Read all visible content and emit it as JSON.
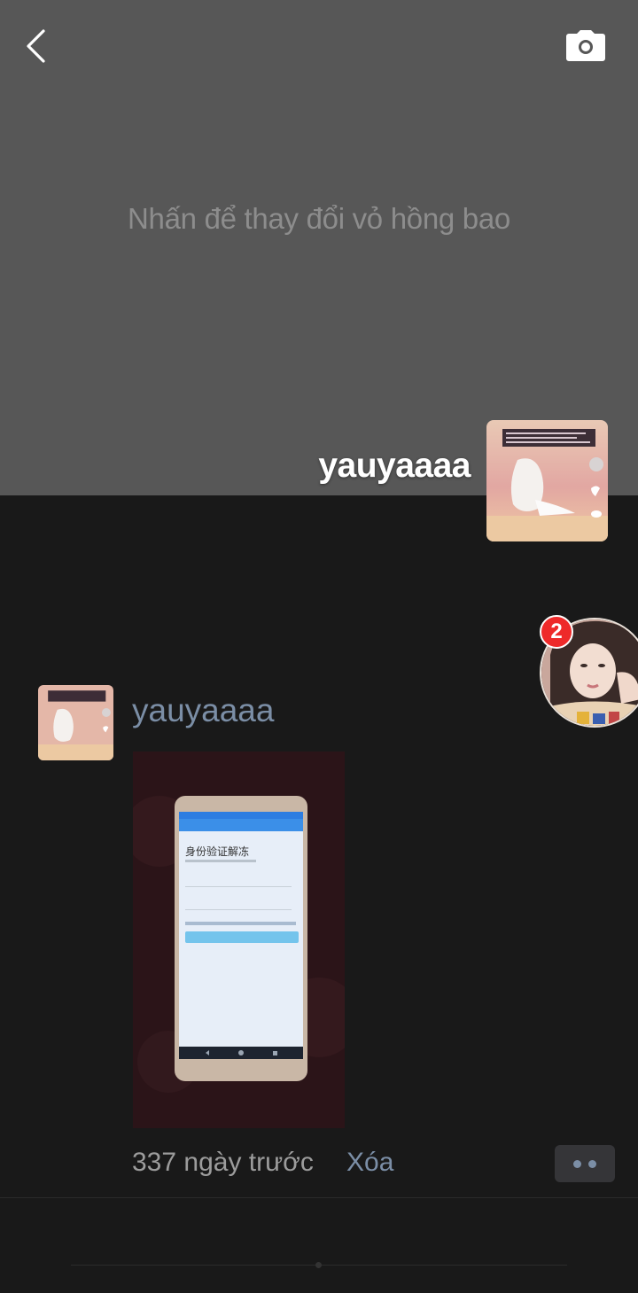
{
  "header": {
    "back_icon": "chevron-left-icon",
    "camera_icon": "camera-icon",
    "cover_hint": "Nhấn để thay đổi vỏ hồng bao",
    "username": "yauyaaaa"
  },
  "floating_contact": {
    "badge_count": "2"
  },
  "post": {
    "author": "yauyaaaa",
    "time": "337 ngày trước",
    "delete_label": "Xóa",
    "image_heading": "身份验证解冻"
  },
  "colors": {
    "cover_bg": "#575757",
    "page_bg": "#191919",
    "link_blue": "#7b8ea6",
    "badge_red": "#ee2a2a"
  }
}
